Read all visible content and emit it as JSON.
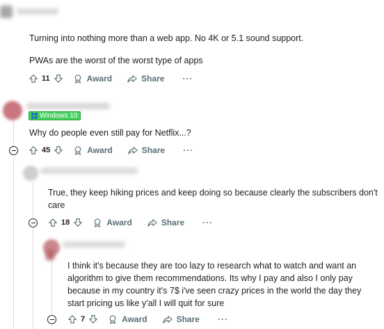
{
  "comments": [
    {
      "lines": [
        "Turning into nothing more than a web app. No 4K or 5.1 sound support.",
        "",
        "PWAs are the worst of the worst type of apps"
      ],
      "votes": "11",
      "award_label": "Award",
      "share_label": "Share",
      "more_label": "···"
    },
    {
      "flair": "Windows 10",
      "lines": [
        "Why do people even still pay for Netflix...?"
      ],
      "votes": "45",
      "award_label": "Award",
      "share_label": "Share",
      "more_label": "···"
    },
    {
      "lines": [
        "True, they keep hiking prices and keep doing so because clearly the subscribers don't",
        "care"
      ],
      "votes": "18",
      "award_label": "Award",
      "share_label": "Share",
      "more_label": "···"
    },
    {
      "lines": [
        "I think it's because they are too lazy to research what to watch and want an",
        "algorithm to give them recommendations. Its why I pay and also I only pay",
        "because in my country it's 7$ i've seen crazy prices in the world the day they",
        "start pricing us like y'all I will quit for sure"
      ],
      "votes": "7",
      "award_label": "Award",
      "share_label": "Share",
      "more_label": "···"
    }
  ],
  "colors": {
    "flair_bg": "#46d160",
    "meta_text": "#576f76",
    "thread_line": "#d7dadc"
  },
  "icons": [
    "upvote-icon",
    "downvote-icon",
    "award-icon",
    "share-icon",
    "collapse-icon",
    "windows-logo-icon"
  ]
}
